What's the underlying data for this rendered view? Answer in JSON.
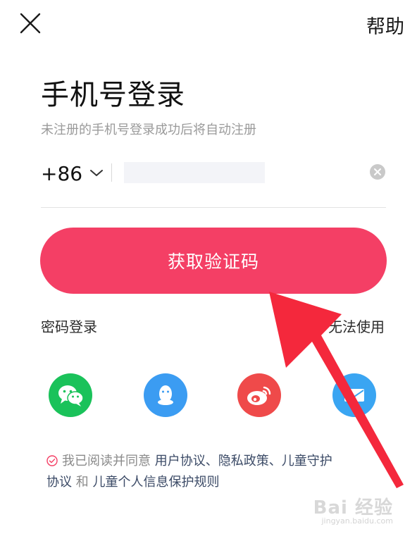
{
  "topbar": {
    "close_icon": "close-icon",
    "help_label": "帮助"
  },
  "title": "手机号登录",
  "subtitle": "未注册的手机号登录成功后将自动注册",
  "phone": {
    "country_code": "+86",
    "value": "",
    "placeholder": ""
  },
  "primary_button": "获取验证码",
  "links": {
    "password_login": "密码登录",
    "unable_to_use": "无法使用"
  },
  "social": [
    {
      "name": "wechat",
      "icon": "wechat-icon",
      "color": "#1ac25a"
    },
    {
      "name": "qq",
      "icon": "qq-icon",
      "color": "#3b9cf2"
    },
    {
      "name": "weibo",
      "icon": "weibo-icon",
      "color": "#ef4a4a"
    },
    {
      "name": "mail",
      "icon": "mail-icon",
      "color": "#3aa5f2"
    }
  ],
  "agreement": {
    "prefix": "我已阅读并同意",
    "user_agreement": "用户协议",
    "sep1": "、",
    "privacy_policy": "隐私政策",
    "sep2": "、",
    "child_protection_a": "儿童守护",
    "child_protection_b": "协议",
    "and": "和",
    "child_info_rules": "儿童个人信息保护规则"
  },
  "watermark": {
    "main": "Bai 经验",
    "sub": "jingyan.baidu.com"
  },
  "colors": {
    "accent": "#f43f65",
    "annotation_arrow": "#f4283c"
  }
}
